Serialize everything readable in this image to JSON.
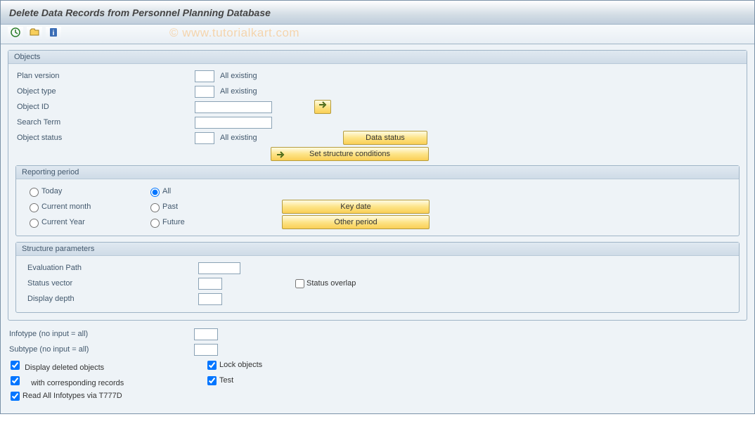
{
  "title": "Delete Data Records from Personnel Planning Database",
  "watermark": "© www.tutorialkart.com",
  "objects": {
    "group_title": "Objects",
    "plan_version_label": "Plan version",
    "plan_version_value": "",
    "plan_version_suffix": "All existing",
    "object_type_label": "Object type",
    "object_type_value": "",
    "object_type_suffix": "All existing",
    "object_id_label": "Object ID",
    "object_id_value": "",
    "search_term_label": "Search Term",
    "search_term_value": "",
    "object_status_label": "Object status",
    "object_status_value": "",
    "object_status_suffix": "All existing",
    "data_status_btn": "Data status",
    "set_struct_btn": "Set structure conditions"
  },
  "reporting": {
    "group_title": "Reporting period",
    "opt_today": "Today",
    "opt_all": "All",
    "opt_curmonth": "Current month",
    "opt_past": "Past",
    "opt_curyear": "Current Year",
    "opt_future": "Future",
    "selected": "All",
    "key_date_btn": "Key date",
    "other_period_btn": "Other period"
  },
  "structure": {
    "group_title": "Structure parameters",
    "eval_path_label": "Evaluation Path",
    "eval_path_value": "",
    "status_vector_label": "Status vector",
    "status_vector_value": "",
    "status_overlap_label": "Status overlap",
    "status_overlap_checked": false,
    "display_depth_label": "Display depth",
    "display_depth_value": ""
  },
  "bottom": {
    "infotype_label": "Infotype (no input = all)",
    "infotype_value": "",
    "subtype_label": "Subtype (no input = all)",
    "subtype_value": "",
    "display_deleted_label": "Display deleted objects",
    "display_deleted_checked": true,
    "lock_objects_label": "Lock objects",
    "lock_objects_checked": true,
    "with_corr_label": "   with corresponding records",
    "with_corr_checked": true,
    "test_label": "Test",
    "test_checked": true,
    "read_all_label": "Read All Infotypes via T777D",
    "read_all_checked": true
  }
}
